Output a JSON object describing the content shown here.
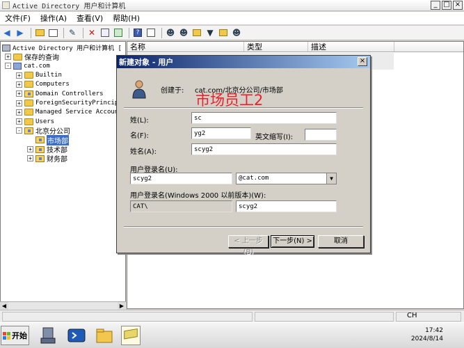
{
  "window": {
    "title": "Active Directory 用户和计算机"
  },
  "menubar": [
    "文件(F)",
    "操作(A)",
    "查看(V)",
    "帮助(H)"
  ],
  "toolbar_icons": [
    "back-arrow-icon",
    "forward-arrow-icon",
    "up-folder-icon",
    "show-tree-icon",
    "edit-icon",
    "delete-icon",
    "properties-icon",
    "export-icon",
    "help-icon",
    "help-topics-icon",
    "mmc-icon",
    "new-user-icon",
    "new-group-icon",
    "new-ou-icon",
    "filter-icon",
    "find-icon",
    "add-member-icon"
  ],
  "tree": {
    "root": "Active Directory 用户和计算机 [",
    "items": [
      {
        "label": "保存的查询",
        "indent": 1,
        "expander": "+",
        "icon": "folder"
      },
      {
        "label": "cat.com",
        "indent": 1,
        "expander": "-",
        "icon": "domain"
      },
      {
        "label": "Builtin",
        "indent": 2,
        "expander": "+",
        "icon": "folder"
      },
      {
        "label": "Computers",
        "indent": 2,
        "expander": "+",
        "icon": "folder"
      },
      {
        "label": "Domain Controllers",
        "indent": 2,
        "expander": "+",
        "icon": "ou"
      },
      {
        "label": "ForeignSecurityPrincipa",
        "indent": 2,
        "expander": "+",
        "icon": "folder"
      },
      {
        "label": "Managed Service Account",
        "indent": 2,
        "expander": "+",
        "icon": "folder"
      },
      {
        "label": "Users",
        "indent": 2,
        "expander": "+",
        "icon": "folder"
      },
      {
        "label": "北京分公司",
        "indent": 2,
        "expander": "-",
        "icon": "ou"
      },
      {
        "label": "市场部",
        "indent": 3,
        "expander": "",
        "icon": "ou",
        "selected": true
      },
      {
        "label": "技术部",
        "indent": 3,
        "expander": "+",
        "icon": "ou"
      },
      {
        "label": "财务部",
        "indent": 3,
        "expander": "+",
        "icon": "ou"
      }
    ]
  },
  "list": {
    "columns": [
      "名称",
      "类型",
      "描述"
    ]
  },
  "dialog": {
    "title": "新建对象 - 用户",
    "created_in_label": "创建于:",
    "created_in_path": "cat.com/北京分公司/市场部",
    "annotation": "市场员工2",
    "surname_label": "姓(L):",
    "surname_value": "sc",
    "given_label": "名(F):",
    "given_value": "yg2",
    "initials_label": "英文缩写(I):",
    "initials_value": "",
    "fullname_label": "姓名(A):",
    "fullname_value": "scyg2",
    "logon_label": "用户登录名(U):",
    "logon_value": "scyg2",
    "domain_suffix": "@cat.com",
    "prewin_label": "用户登录名(Windows 2000 以前版本)(W):",
    "prewin_domain": "CAT\\",
    "prewin_value": "scyg2",
    "back_button": "< 上一步(B)",
    "next_button": "下一步(N) >",
    "cancel_button": "取消"
  },
  "taskbar": {
    "start_label": "开始",
    "time": "17:42",
    "date": "2024/8/14",
    "lang": "CH"
  }
}
